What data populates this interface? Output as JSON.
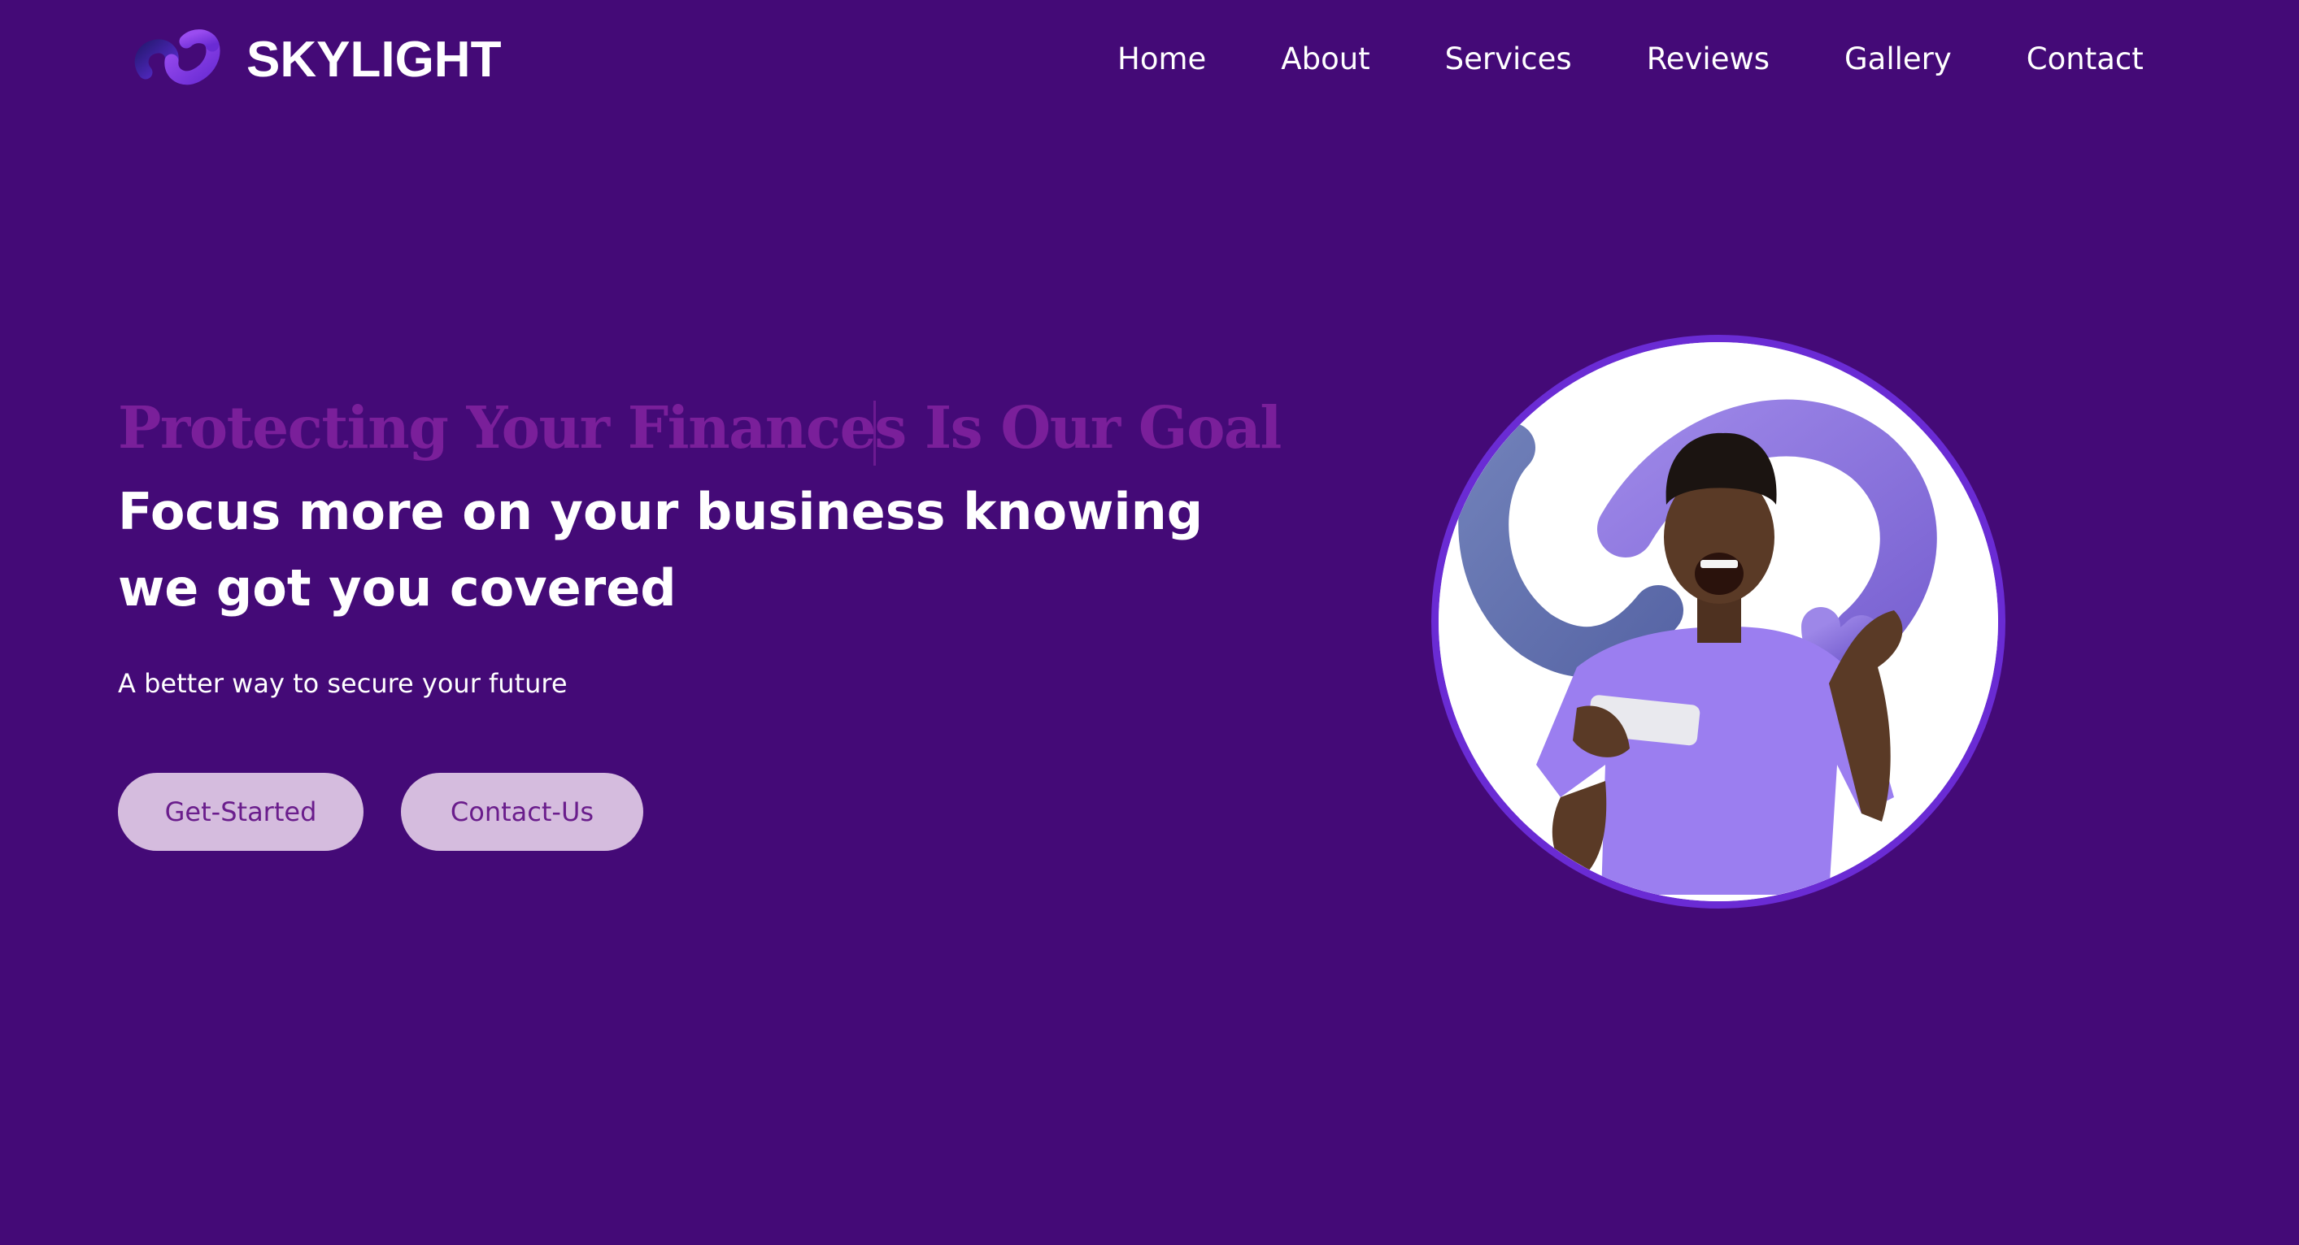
{
  "header": {
    "brand_name": "SKYLIGHT",
    "logo_icon": "chain-link-icon",
    "nav": [
      {
        "label": "Home"
      },
      {
        "label": "About"
      },
      {
        "label": "Services"
      },
      {
        "label": "Reviews"
      },
      {
        "label": "Gallery"
      },
      {
        "label": "Contact"
      }
    ]
  },
  "hero": {
    "tagline_before_caret": "Protecting Your Finance",
    "tagline_after_caret": "s Is Our Goal",
    "headline": "Focus more on your business knowing we got you covered",
    "subtitle": "A better way to secure your future",
    "primary_button": "Get-Started",
    "secondary_button": "Contact-Us",
    "image_icon": "excited-man-with-phone-image"
  },
  "colors": {
    "background": "#440a77",
    "tagline": "#7a1f9a",
    "button_bg": "#d5bcde",
    "button_text": "#6a1d8c",
    "image_ring": "#6a2bd4"
  }
}
